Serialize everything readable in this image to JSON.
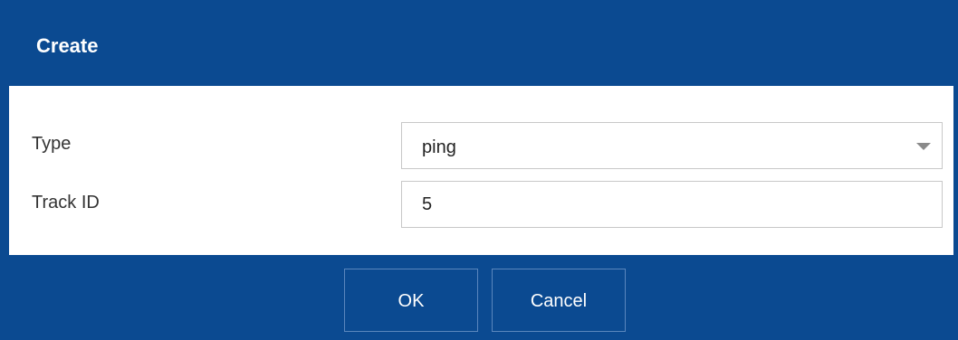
{
  "dialog": {
    "title": "Create"
  },
  "form": {
    "type": {
      "label": "Type",
      "value": "ping"
    },
    "track_id": {
      "label": "Track ID",
      "value": "5"
    }
  },
  "buttons": {
    "ok_label": "OK",
    "cancel_label": "Cancel"
  },
  "colors": {
    "primary": "#0b4a91",
    "border": "#c8c8c8",
    "text": "#333333"
  }
}
